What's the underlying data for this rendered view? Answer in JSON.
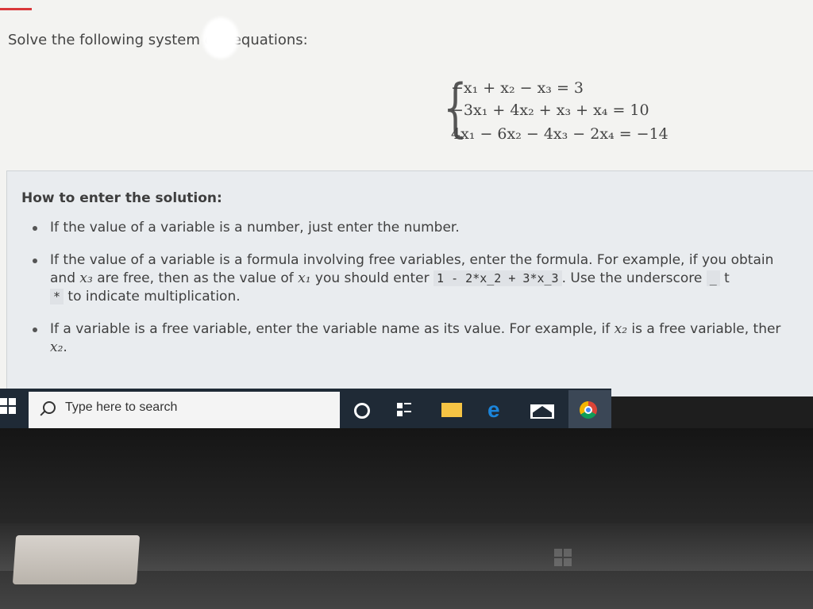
{
  "problem": {
    "intro": "Solve the following system ",
    "intro_tail": "ear equations:",
    "equations": [
      "−x₁ + x₂ − x₃ = 3",
      "−3x₁ + 4x₂ + x₃ + x₄ = 10",
      "4x₁ − 6x₂ − 4x₃ − 2x₄ = −14"
    ]
  },
  "help": {
    "title": "How to enter the solution:",
    "items": [
      {
        "text": "If the value of a variable is a number, just enter the number."
      },
      {
        "part1": "If the value of a variable is a formula involving free variables, enter the formula. For example, if you obtain ",
        "part2": "and ",
        "var_a": "x₃",
        "part3": " are free, then as the value of ",
        "var_b": "x₁",
        "part4": " you should enter ",
        "code": "1 - 2*x_2 + 3*x_3",
        "part5": ". Use the underscore ",
        "underscore": "_",
        "part6": " t",
        "star": "*",
        "part7": " to indicate multiplication."
      },
      {
        "part1": "If a variable is a free variable, enter the variable name as its value. For example, if ",
        "var_a": "x₂",
        "part2": " is a free variable, ther",
        "var_b": "x₂",
        "part3": "."
      }
    ]
  },
  "taskbar": {
    "search_placeholder": "Type here to search",
    "apps": [
      "cortana-icon",
      "task-view-icon",
      "file-explorer-icon",
      "edge-icon",
      "mail-icon",
      "chrome-icon"
    ]
  }
}
